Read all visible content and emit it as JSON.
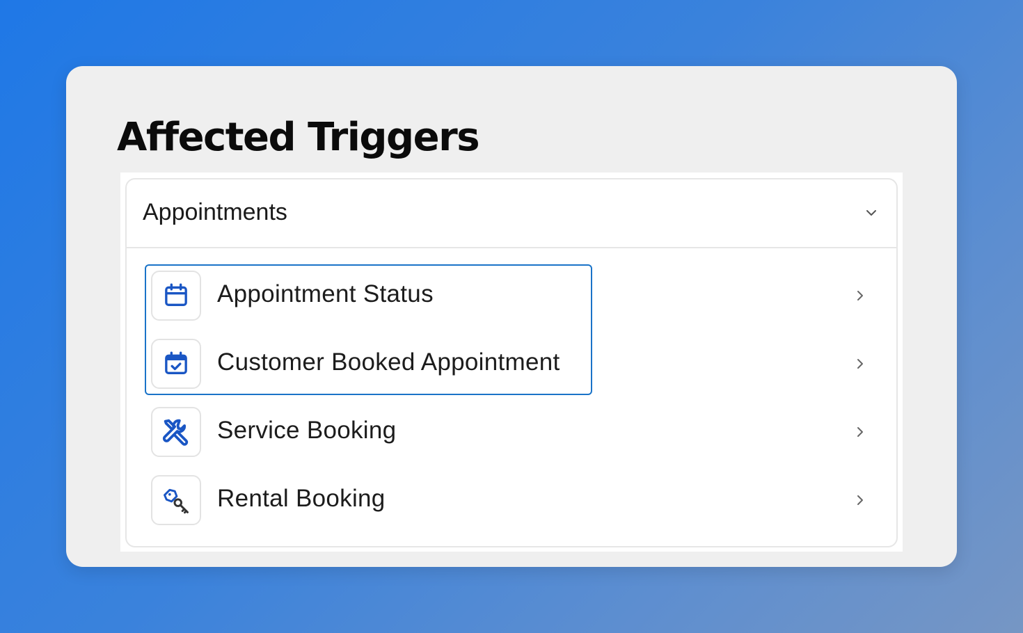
{
  "page": {
    "title": "Affected Triggers"
  },
  "accordion": {
    "title": "Appointments",
    "toggle_icon": "chevron-down-icon",
    "items": [
      {
        "label": "Appointment Status",
        "icon": "calendar-icon",
        "highlighted": true
      },
      {
        "label": "Customer Booked Appointment",
        "icon": "calendar-check-icon",
        "highlighted": true
      },
      {
        "label": "Service Booking",
        "icon": "tools-icon",
        "highlighted": false
      },
      {
        "label": "Rental Booking",
        "icon": "key-icon",
        "highlighted": false
      }
    ]
  },
  "colors": {
    "background_gradient": [
      "#1f78e6",
      "#7696c4"
    ],
    "card": "#efefef",
    "icon_blue": "#1a56c4",
    "highlight_border": "#1a73c8"
  }
}
